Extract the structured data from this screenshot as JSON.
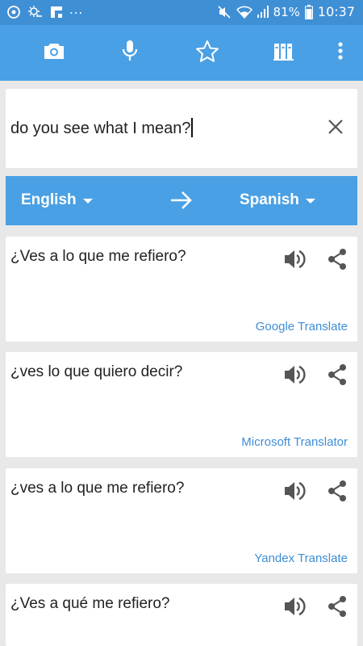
{
  "status_bar": {
    "dots": "...",
    "battery": "81%",
    "time": "10:37"
  },
  "toolbar": {
    "icons": [
      "camera-icon",
      "microphone-icon",
      "star-icon",
      "library-icon",
      "overflow-menu-icon"
    ]
  },
  "input": {
    "text": "do you see what I mean?"
  },
  "languages": {
    "source": "English",
    "target": "Spanish"
  },
  "results": [
    {
      "text": "¿Ves a lo que me refiero?",
      "provider": "Google Translate"
    },
    {
      "text": "¿ves lo que quiero decir?",
      "provider": "Microsoft Translator"
    },
    {
      "text": "¿ves a lo que me refiero?",
      "provider": "Yandex Translate"
    },
    {
      "text": "¿Ves a qué me refiero?",
      "provider": ""
    }
  ],
  "colors": {
    "status_bar": "#3f8fd5",
    "toolbar": "#4aa0e4",
    "background": "#e8e8e8",
    "provider_link": "#3e8ed6"
  }
}
